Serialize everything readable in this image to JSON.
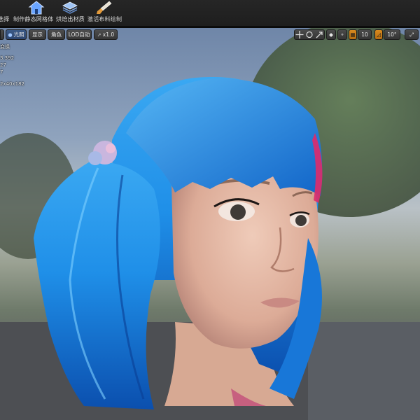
{
  "toolbar": {
    "items": [
      {
        "label": "选择",
        "icon": "select-icon"
      },
      {
        "label": "制作静态网格体",
        "icon": "static-mesh-house-icon"
      },
      {
        "label": "烘焙出材质",
        "icon": "bake-material-layers-icon"
      },
      {
        "label": "激活布料绘制",
        "icon": "cloth-paint-brush-icon"
      }
    ]
  },
  "viewport": {
    "menu_icon": "menu-icon",
    "buttons": {
      "lit": "光照",
      "show": "显示",
      "character": "角色",
      "lod": "LOD自动",
      "speed": "x1.0"
    },
    "right": {
      "grid_snap": "10",
      "rotation_snap": "10°"
    },
    "stats": [
      "变换",
      "3.392",
      "27",
      "7",
      "2x40x182"
    ]
  },
  "colors": {
    "hair": "#1f8fe8",
    "hair_dark": "#0b4fae",
    "skin": "#e7bfae",
    "accent_orange": "#d88a1f",
    "toolbar_bg": "#262626"
  }
}
